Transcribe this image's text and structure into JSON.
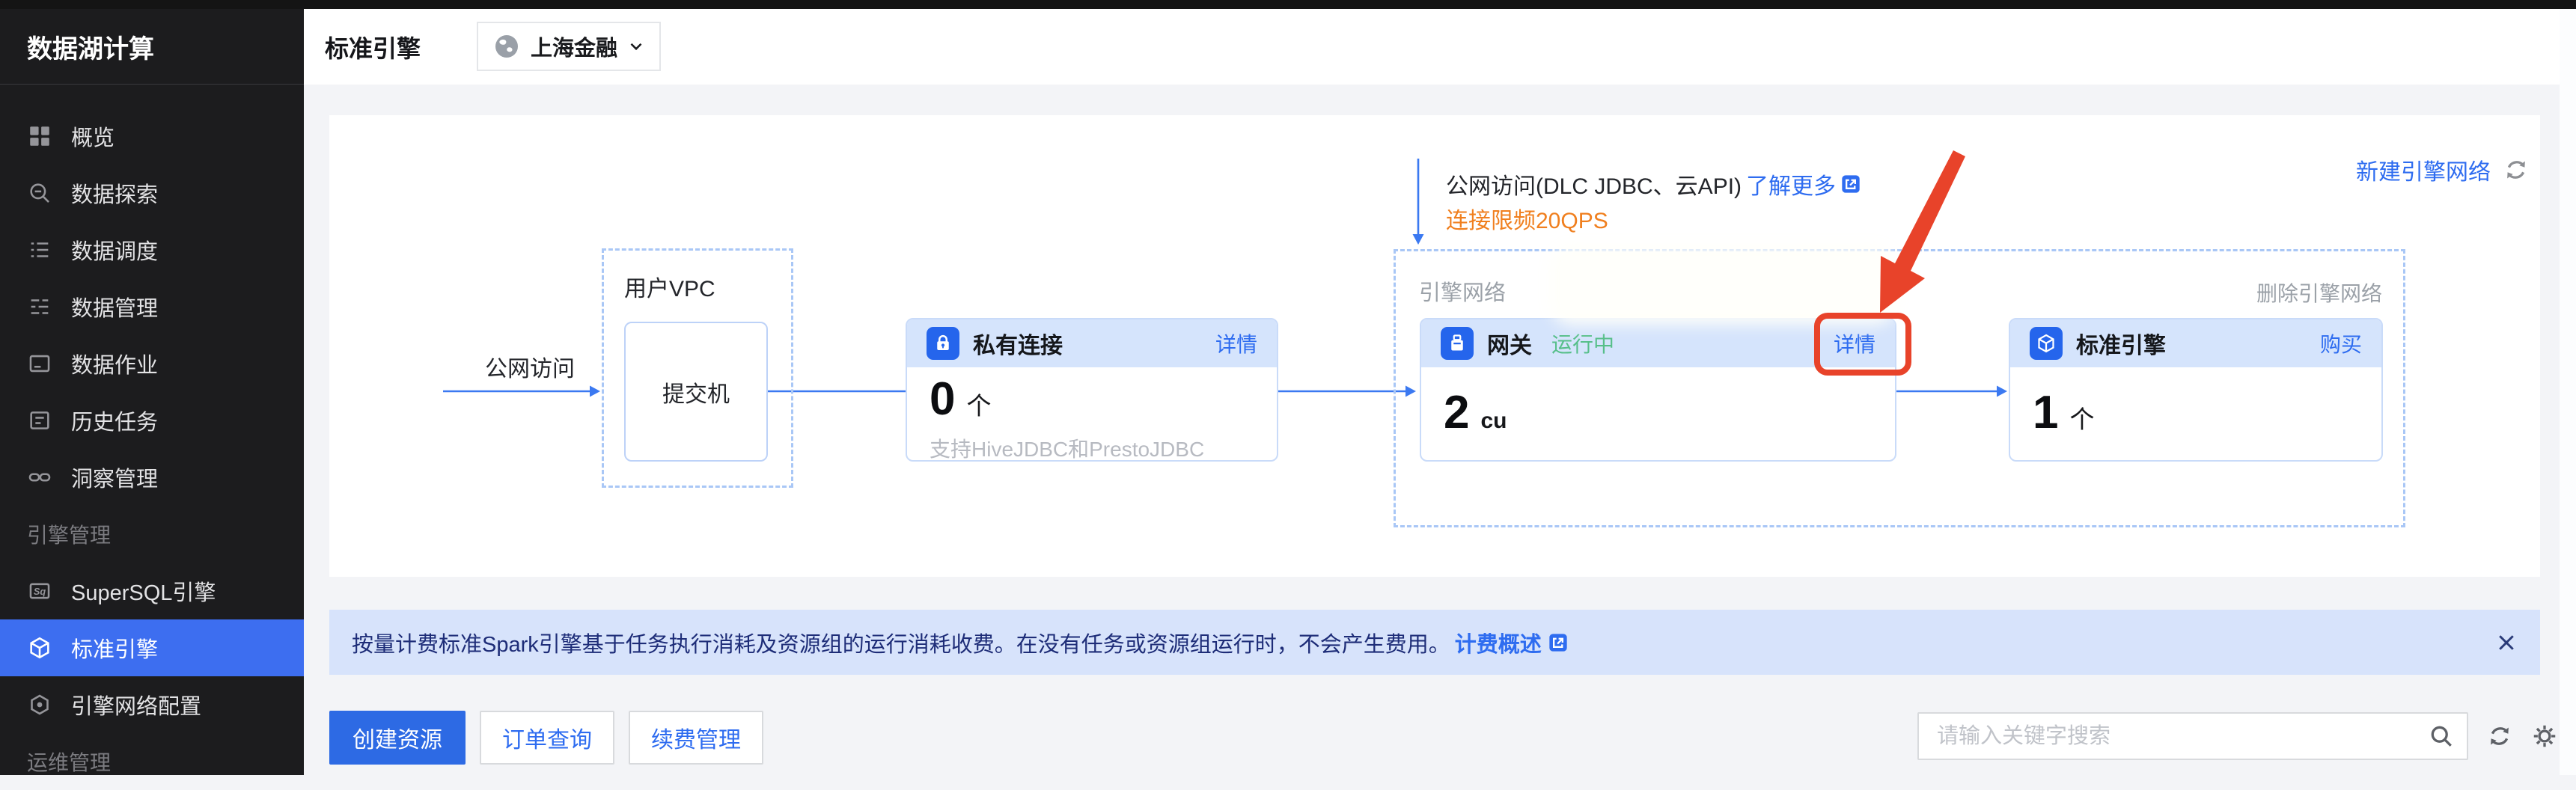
{
  "app": {
    "product_title": "数据湖计算"
  },
  "sidebar": {
    "items": [
      {
        "label": "概览",
        "icon": "overview"
      },
      {
        "label": "数据探索",
        "icon": "explore"
      },
      {
        "label": "数据调度",
        "icon": "schedule"
      },
      {
        "label": "数据管理",
        "icon": "manage"
      },
      {
        "label": "数据作业",
        "icon": "job"
      },
      {
        "label": "历史任务",
        "icon": "history"
      },
      {
        "label": "洞察管理",
        "icon": "insight"
      },
      {
        "label": "引擎管理",
        "section": true
      },
      {
        "label": "SuperSQL引擎",
        "icon": "supersql"
      },
      {
        "label": "标准引擎",
        "icon": "cube",
        "active": true
      },
      {
        "label": "引擎网络配置",
        "icon": "netconfig"
      },
      {
        "label": "运维管理",
        "section": true
      }
    ]
  },
  "header": {
    "title": "标准引擎",
    "region": "上海金融"
  },
  "diagram": {
    "public_access_label": "公网访问",
    "user_vpc": {
      "label": "用户VPC",
      "inner_box": "提交机"
    },
    "private_link_card": {
      "title": "私有连接",
      "action": "详情",
      "count": "0",
      "unit": "个",
      "caption": "支持HiveJDBC和PrestoJDBC"
    },
    "annotation": {
      "line1": "公网访问(DLC JDBC、云API)",
      "link": "了解更多",
      "line2": "连接限频20QPS"
    },
    "engine_network": {
      "label": "引擎网络",
      "delete_action": "删除引擎网络"
    },
    "gateway_card": {
      "title": "网关",
      "status": "运行中",
      "action": "详情",
      "count": "2",
      "unit": "cu"
    },
    "engine_card": {
      "title": "标准引擎",
      "action": "购买",
      "count": "1",
      "unit": "个"
    },
    "new_network_link": "新建引擎网络"
  },
  "notice": {
    "text": "按量计费标准Spark引擎基于任务执行消耗及资源组的运行消耗收费。在没有任务或资源组运行时，不会产生费用。",
    "link": "计费概述"
  },
  "toolbar": {
    "create_label": "创建资源",
    "orders_label": "订单查询",
    "renewal_label": "续费管理",
    "search_placeholder": "请输入关键字搜索"
  },
  "colors": {
    "accent_blue": "#2e6cf0",
    "sidebar_active": "#3d6ef0",
    "card_header": "#d5e4fc",
    "status_green": "#57bf8a",
    "warn_orange": "#f07f1e",
    "highlight_red": "#e8432a",
    "notice_bg": "#d7e3fb",
    "notice_text": "#1e2d78",
    "primary_btn": "#2d6ae4"
  }
}
